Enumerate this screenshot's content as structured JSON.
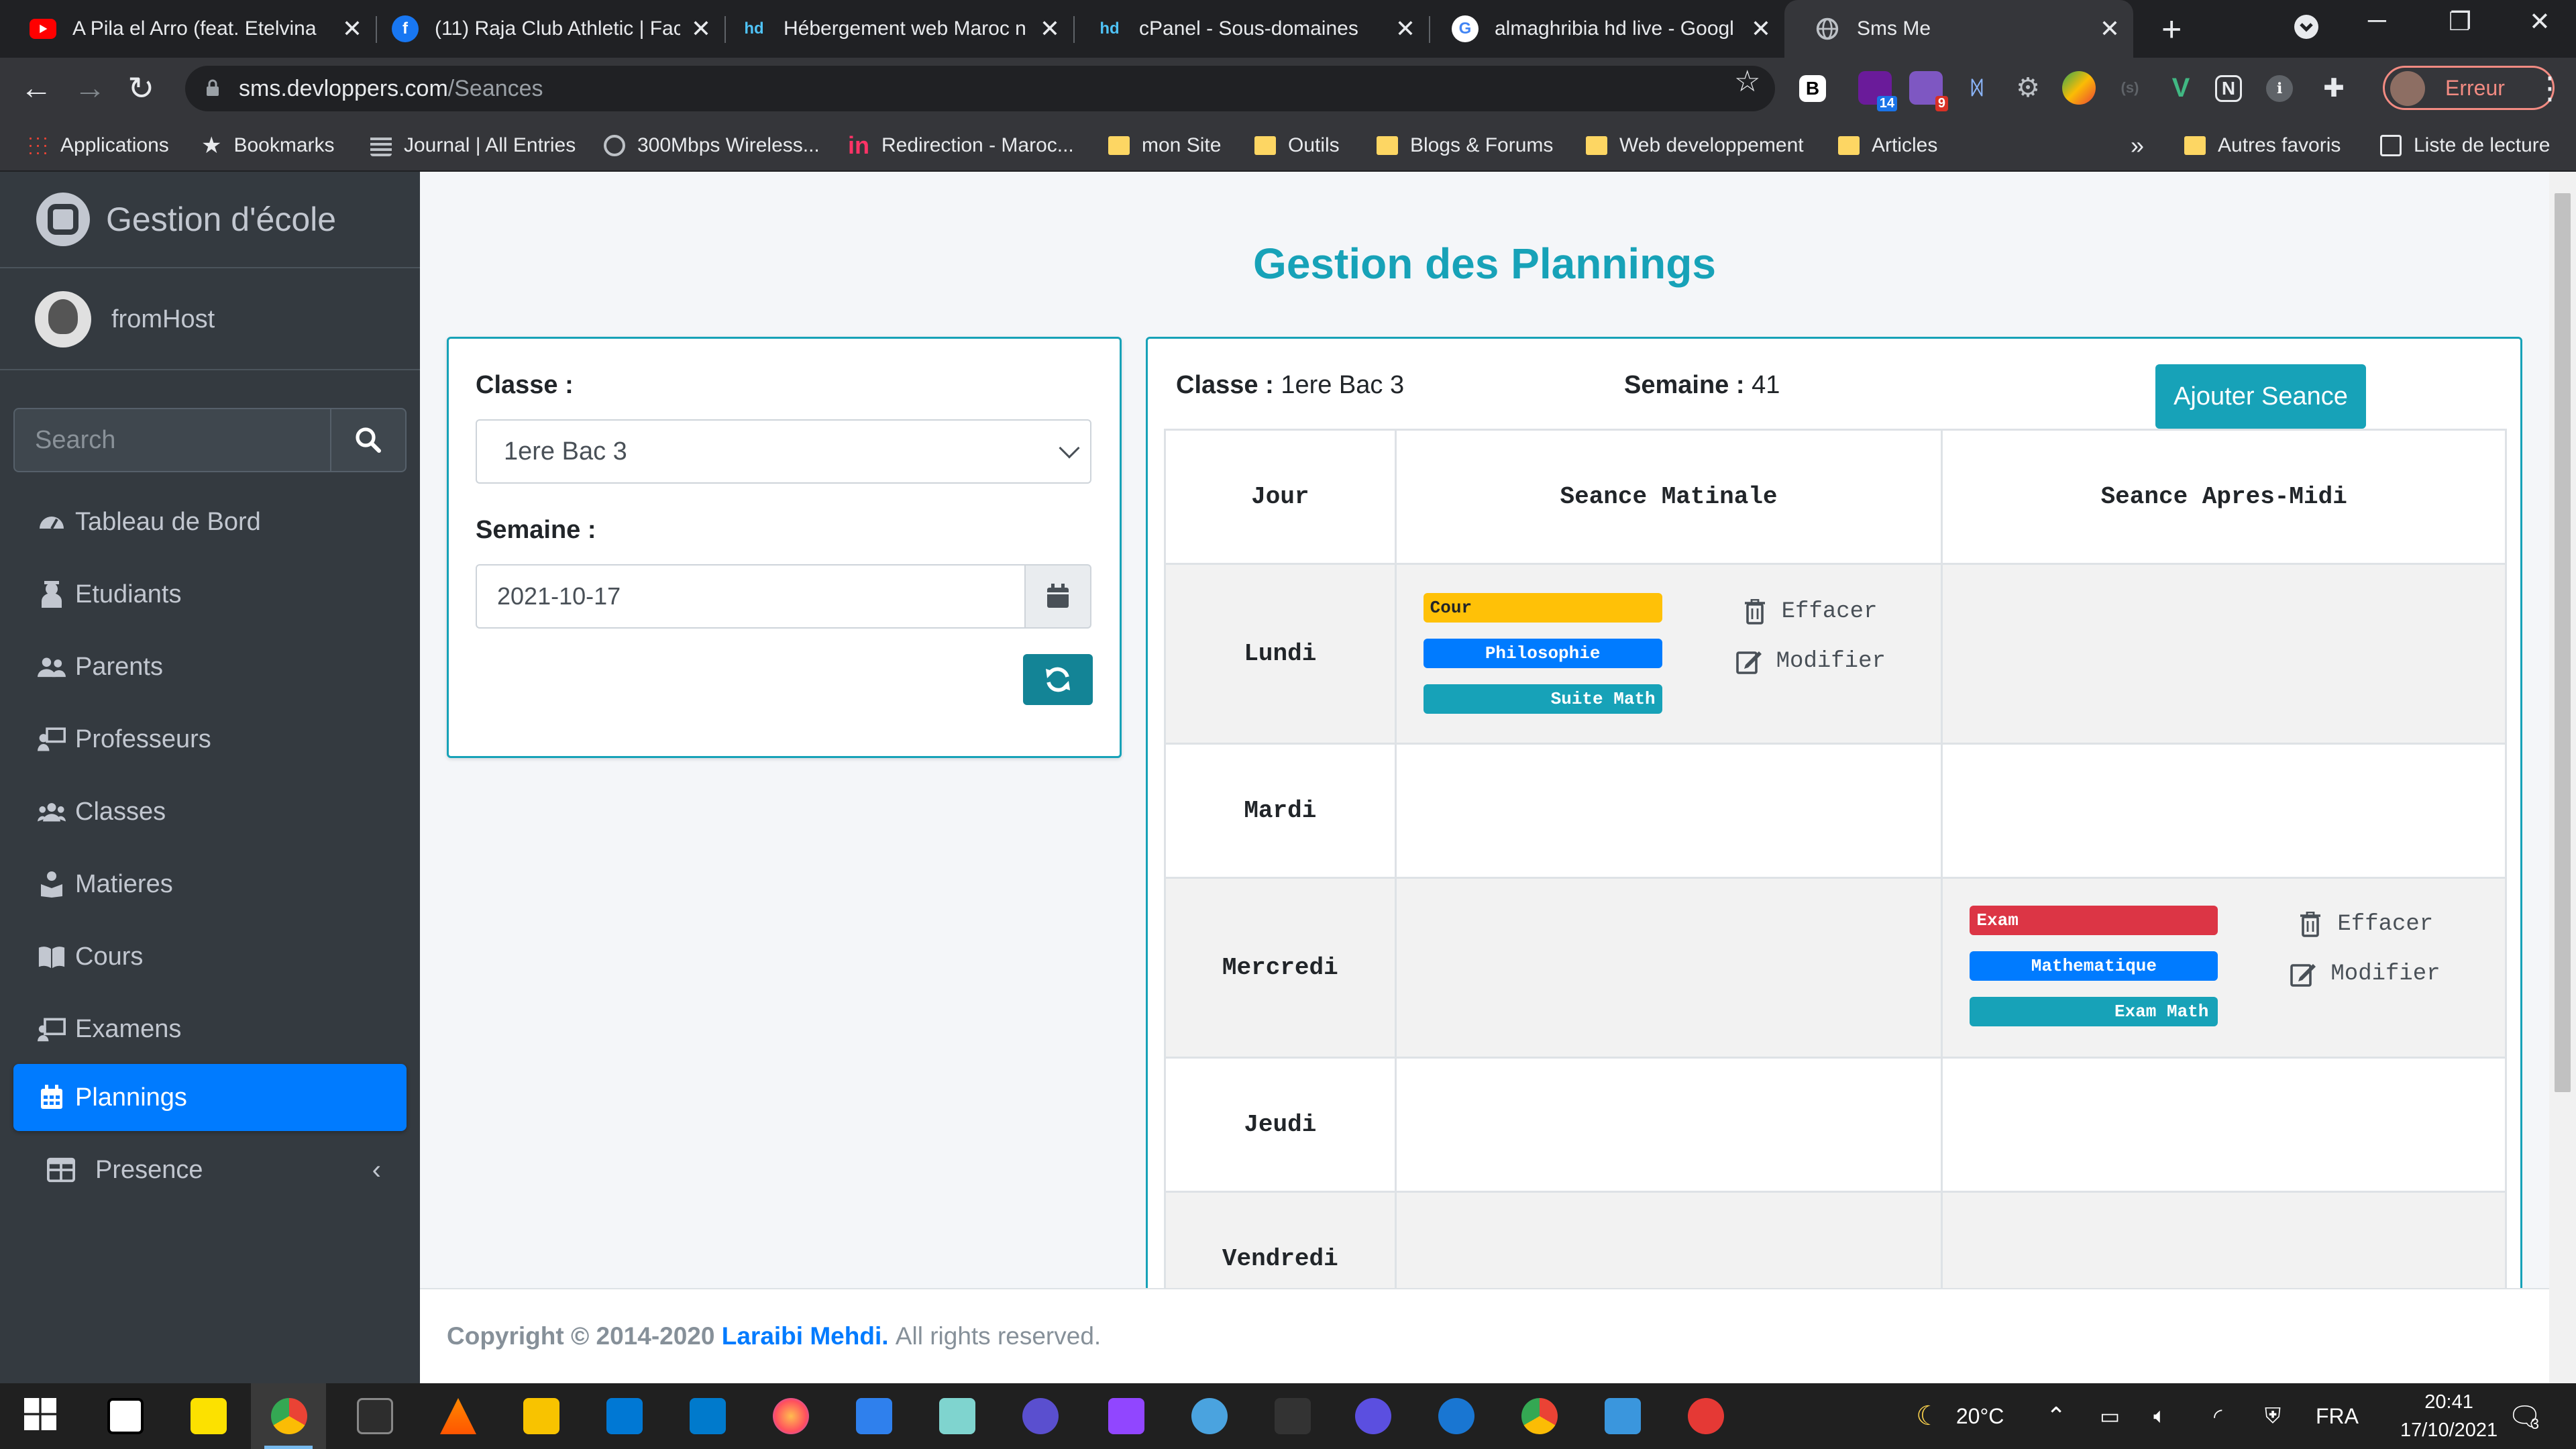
{
  "browser": {
    "tabs": [
      {
        "title": "A Pila el Arro (feat. Etelvina",
        "icon": "youtube-icon",
        "color": "#ff0000"
      },
      {
        "title": "(11) Raja Club Athletic | Face",
        "icon": "facebook-icon",
        "color": "#1877f2"
      },
      {
        "title": "Hébergement web Maroc n",
        "icon": "hd-icon",
        "color": "#4fc3f7"
      },
      {
        "title": "cPanel - Sous-domaines",
        "icon": "hd-icon",
        "color": "#4fc3f7"
      },
      {
        "title": "almaghribia hd live - Googl",
        "icon": "google-icon",
        "color": "#ffffff"
      },
      {
        "title": "Sms Me",
        "icon": "globe-icon",
        "color": "#9aa0a6"
      }
    ],
    "url_host": "sms.devloppers.com",
    "url_path": "/Seances",
    "profile_label": "Erreur",
    "extension_badges": [
      "14",
      "9"
    ],
    "bookmarks": [
      {
        "label": "Applications",
        "icon": "apps-grid-icon"
      },
      {
        "label": "Bookmarks",
        "icon": "star-icon"
      },
      {
        "label": "Journal | All Entries",
        "icon": "journal-icon"
      },
      {
        "label": "300Mbps Wireless...",
        "icon": "globe-icon"
      },
      {
        "label": "Redirection - Maroc...",
        "icon": "invision-icon"
      },
      {
        "label": "mon Site",
        "icon": "folder-icon"
      },
      {
        "label": "Outils",
        "icon": "folder-icon"
      },
      {
        "label": "Blogs & Forums",
        "icon": "folder-icon"
      },
      {
        "label": "Web developpement",
        "icon": "folder-icon"
      },
      {
        "label": "Articles",
        "icon": "folder-icon"
      }
    ],
    "bookmarks_overflow": "»",
    "other_favorites": "Autres favoris",
    "reading_list": "Liste de lecture"
  },
  "sidebar": {
    "brand": "Gestion d'école",
    "user": "fromHost",
    "search_placeholder": "Search",
    "items": [
      {
        "label": "Tableau de Bord",
        "icon": "tachometer-icon"
      },
      {
        "label": "Etudiants",
        "icon": "student-icon"
      },
      {
        "label": "Parents",
        "icon": "users-icon"
      },
      {
        "label": "Professeurs",
        "icon": "teacher-icon"
      },
      {
        "label": "Classes",
        "icon": "group-icon"
      },
      {
        "label": "Matieres",
        "icon": "book-reader-icon"
      },
      {
        "label": "Cours",
        "icon": "book-open-icon"
      },
      {
        "label": "Examens",
        "icon": "exam-icon"
      },
      {
        "label": "Plannings",
        "icon": "calendar-icon",
        "active": true
      },
      {
        "label": "Presence",
        "icon": "table-icon"
      }
    ]
  },
  "main": {
    "title": "Gestion des Plannings",
    "filter": {
      "classe_label": "Classe :",
      "classe_value": "1ere Bac 3",
      "semaine_label": "Semaine :",
      "date_value": "2021-10-17"
    },
    "planning": {
      "classe_label": "Classe :",
      "classe_value": "1ere Bac 3",
      "semaine_label": "Semaine :",
      "semaine_value": "41",
      "add_button": "Ajouter Seance",
      "headers": [
        "Jour",
        "Seance Matinale",
        "Seance Apres-Midi"
      ],
      "days": [
        "Lundi",
        "Mardi",
        "Mercredi",
        "Jeudi",
        "Vendredi"
      ],
      "sessions": [
        {
          "day": "Lundi",
          "slot": "Seance Matinale",
          "type": "Cour",
          "subject": "Philosophie",
          "title": "Suite Math"
        },
        {
          "day": "Mercredi",
          "slot": "Seance Apres-Midi",
          "type": "Exam",
          "subject": "Mathematique",
          "title": "Exam Math"
        }
      ],
      "delete_label": "Effacer",
      "edit_label": "Modifier"
    }
  },
  "footer": {
    "copyright": "Copyright © 2014-2020",
    "author": "Laraibi Mehdi.",
    "rights": "All rights reserved."
  },
  "taskbar": {
    "weather": "20°C",
    "language": "FRA",
    "time": "20:41",
    "date": "17/10/2021",
    "notifications": "3"
  },
  "colors": {
    "accent": "#17a2b8",
    "primary": "#007bff",
    "warning": "#ffc107",
    "danger": "#dc3545",
    "sidebar": "#343a40"
  }
}
